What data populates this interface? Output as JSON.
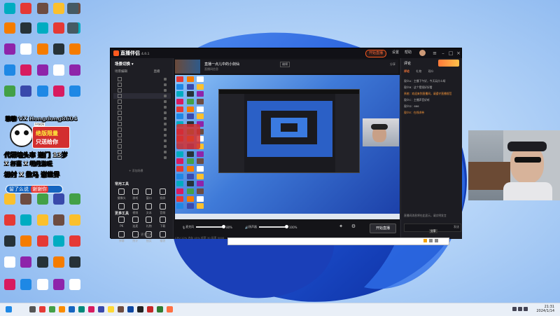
{
  "overlay": {
    "line1": "聊聊 VX Hongdong8604",
    "badge_brand": "FANDE",
    "badge_line1": "绝版限量",
    "badge_line2": "只送给你",
    "line2": "代研培头市 迦门 13岁",
    "line3": "X 杯喜 X 明月游玩",
    "line4": "相村 X 数马 谢世界",
    "pill_text": "留了么说",
    "pill_highlight": "谢谢你"
  },
  "app": {
    "brand": "直播伴侣",
    "version": "4.0.1",
    "live_button": "开始直播",
    "top_actions": [
      "设置",
      "帮助"
    ],
    "sidebar": {
      "title": "场景切换 ▾",
      "tabs": [
        "场景编辑",
        "直播"
      ],
      "scenes": [
        "",
        "",
        "",
        "",
        "",
        "",
        "",
        "",
        "",
        "",
        "",
        "",
        "",
        "",
        ""
      ],
      "add_scene": "+ 添加场景",
      "section_tools": "常用工具",
      "tools": [
        "摄像头",
        "游戏",
        "窗口",
        "投屏",
        "图片",
        "视频",
        "文本",
        "音频"
      ],
      "section_more": "更多工具",
      "more_tools": [
        "PK",
        "连麦",
        "礼物",
        "下载",
        "弹幕",
        "统计",
        "抽奖",
        "福袋"
      ],
      "more_label": "··· 更多工具"
    },
    "room": {
      "title": "直播一点儿中的小剑仙",
      "subtitle": "直播间信息",
      "edit_label": "编辑",
      "right_label": "分享"
    },
    "controls": {
      "mic_label": "麦克风",
      "mic_value": "80%",
      "speaker_label": "扬声器",
      "speaker_value": "100%",
      "start_label": "开始直播"
    },
    "status_text": "CPU 12%  内存 45%  帧率 30  码率 5000",
    "chat": {
      "title": "评论",
      "tabs": [
        "评论",
        "礼物",
        "观众"
      ],
      "messages": [
        "观众A：主播下午好，今天玩什么呀",
        "观众B：这个壁纸好好看",
        "系统：欢迎来到直播间，请遵守直播规范",
        "观众C：主播声音好听",
        "观众D：666",
        "观众E：在线求带"
      ],
      "notice": "直播间消息将在此显示，请文明发言",
      "tooltip": "分享",
      "send_label": "发送"
    }
  },
  "taskbar": {
    "time": "21:31",
    "date": "2024/1/14"
  },
  "colors": {
    "accent": "#ff5a1f",
    "app_bg": "#1a1a1f",
    "wallpaper_blue": "#2b60c6"
  }
}
